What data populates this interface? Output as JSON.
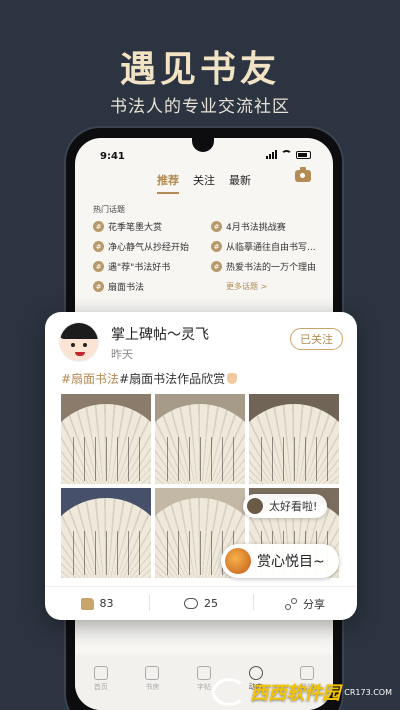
{
  "promo": {
    "title": "遇见书友",
    "subtitle": "书法人的专业交流社区"
  },
  "status_bar": {
    "time": "9:41"
  },
  "feed_tabs": [
    {
      "label": "推荐",
      "active": true
    },
    {
      "label": "关注",
      "active": false
    },
    {
      "label": "最新",
      "active": false
    }
  ],
  "hot_topics": {
    "label": "热门话题",
    "items": [
      "花季笔墨大赏",
      "4月书法挑战赛",
      "净心静气从抄经开始",
      "从临摹通往自由书写...",
      "遇\"荐\"书法好书",
      "热爱书法的一万个理由",
      "扇面书法"
    ],
    "more": "更多话题 >"
  },
  "bottom_nav": [
    {
      "label": "首页",
      "icon": "home-icon",
      "active": false
    },
    {
      "label": "书房",
      "icon": "study-icon",
      "active": false
    },
    {
      "label": "字帖",
      "icon": "copybook-icon",
      "active": false
    },
    {
      "label": "动态",
      "icon": "feed-icon",
      "active": true
    },
    {
      "label": "我的",
      "icon": "profile-icon",
      "active": false
    }
  ],
  "post": {
    "username": "掌上碑帖～灵飞",
    "time": "昨天",
    "follow_label": "已关注",
    "tag1": "#扇面书法",
    "tag2": "#扇面书法作品欣赏",
    "photo_count": 6,
    "comment_bubble_1": "太好看啦!",
    "comment_bubble_2": "赏心悦目~",
    "likes": "83",
    "comments": "25",
    "share_label": "分享"
  },
  "watermark": {
    "brand": "西西软件园",
    "url": "CR173.COM"
  },
  "colors": {
    "background": "#2b3440",
    "accent": "#b38b53",
    "hero_title": "#f2e3c5"
  }
}
